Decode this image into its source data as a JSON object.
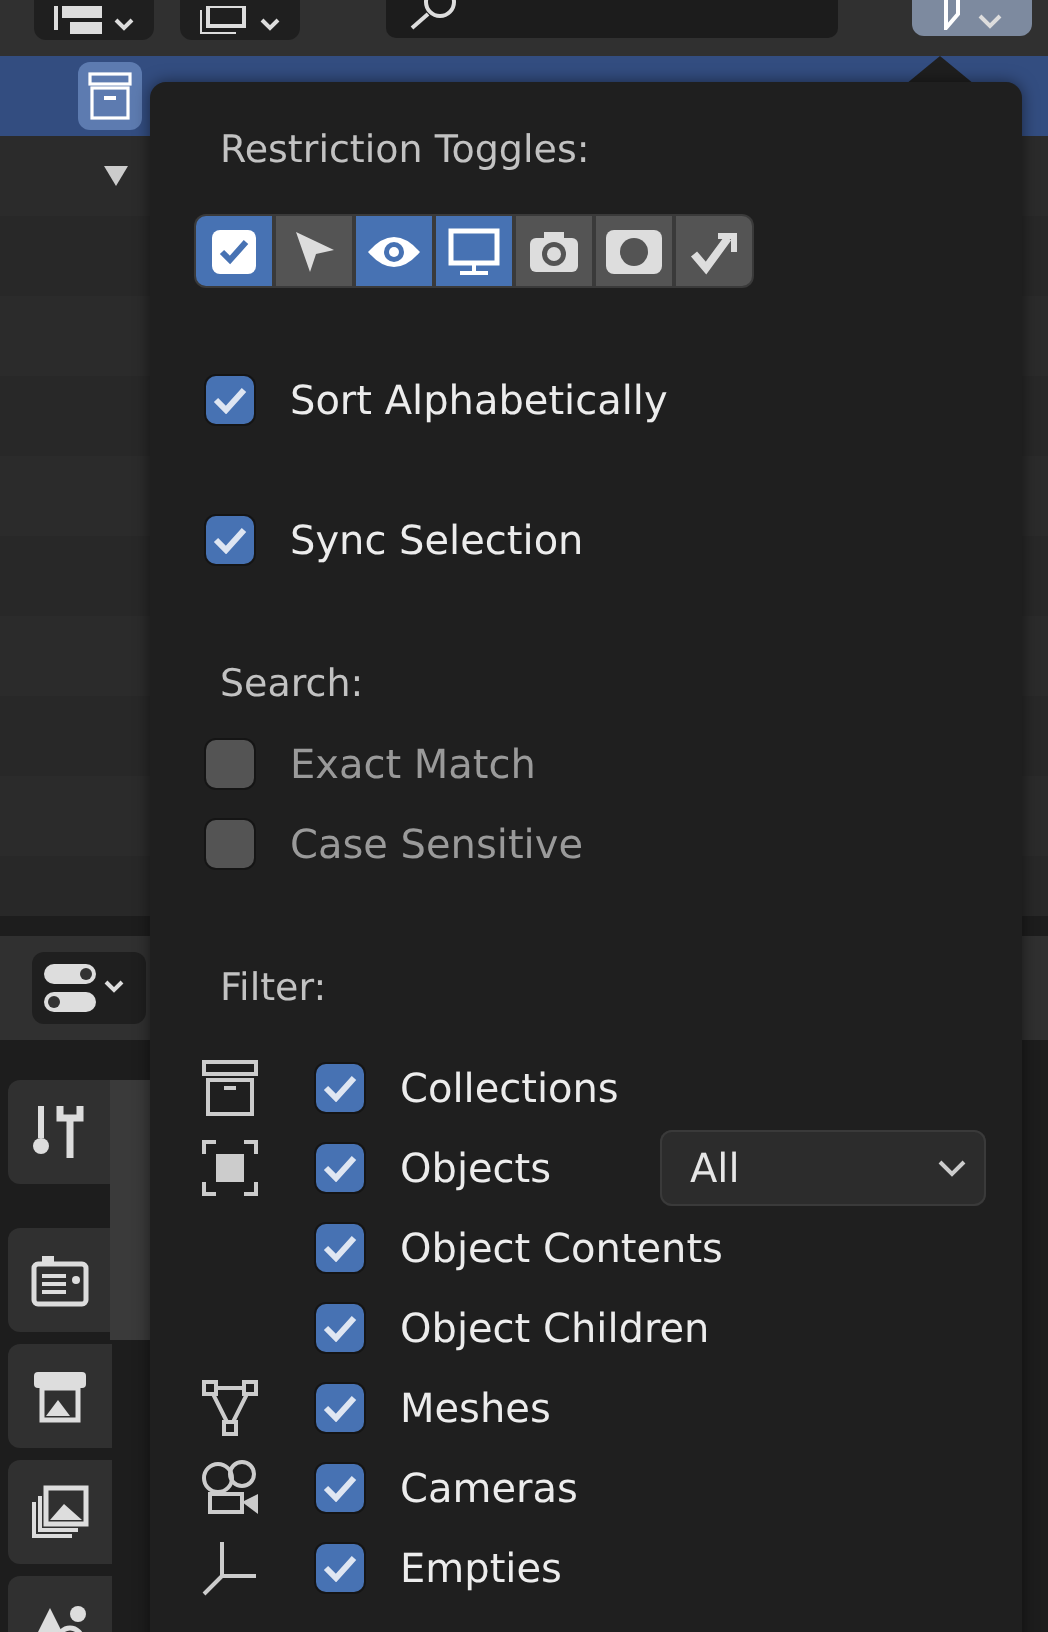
{
  "outliner": {
    "rows": [
      {
        "selected": true
      },
      {
        "selected": false
      },
      {
        "selected": false
      },
      {
        "selected": false
      },
      {
        "selected": false
      },
      {
        "selected": false
      },
      {
        "selected": false
      },
      {
        "selected": false
      },
      {
        "selected": false
      },
      {
        "selected": false
      },
      {
        "selected": false
      }
    ]
  },
  "popover": {
    "restriction_title": "Restriction Toggles:",
    "toggles": [
      {
        "selected": true
      },
      {
        "selected": false
      },
      {
        "selected": true
      },
      {
        "selected": true
      },
      {
        "selected": false
      },
      {
        "selected": false
      },
      {
        "selected": false
      }
    ],
    "options": [
      {
        "label": "Sort Alphabetically",
        "checked": true
      },
      {
        "label": "Sync Selection",
        "checked": true
      }
    ],
    "search_title": "Search:",
    "search_options": [
      {
        "label": "Exact Match",
        "checked": false
      },
      {
        "label": "Case Sensitive",
        "checked": false
      }
    ],
    "filter_title": "Filter:",
    "filters": [
      {
        "label": "Collections",
        "checked": true
      },
      {
        "label": "Objects",
        "checked": true,
        "dropdown": "All"
      },
      {
        "label": "Object Contents",
        "checked": true
      },
      {
        "label": "Object Children",
        "checked": true
      },
      {
        "label": "Meshes",
        "checked": true
      },
      {
        "label": "Cameras",
        "checked": true
      },
      {
        "label": "Empties",
        "checked": true
      }
    ]
  }
}
